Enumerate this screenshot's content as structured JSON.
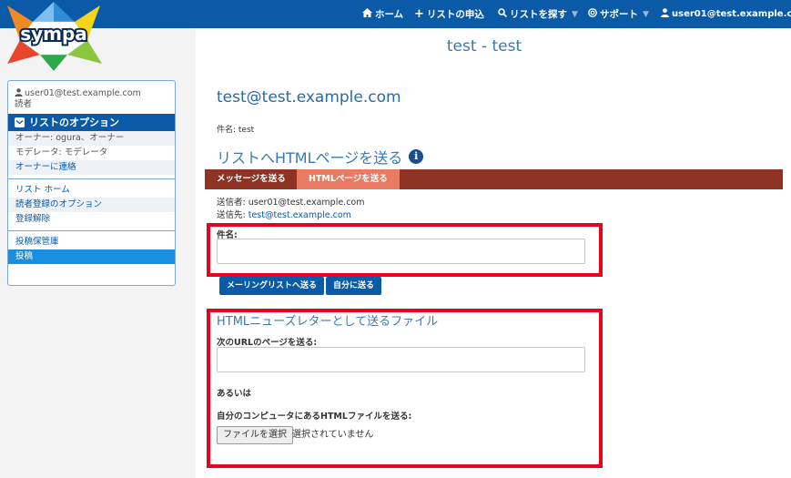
{
  "topnav": {
    "home": "ホーム",
    "request_list": "リストの申込",
    "search_list": "リストを探す",
    "support": "サポート",
    "user": "user01@test.example.com"
  },
  "logo": {
    "text": "sympa"
  },
  "sidebar": {
    "user_email": "user01@test.example.com",
    "user_role": "読者",
    "options_header": "リストのオプション",
    "owner": "オーナー: ogura、オーナー",
    "moderator": "モデレータ: モデレータ",
    "contact_owner": "オーナーに連絡",
    "list_home": "リスト ホーム",
    "subscriber_options": "読者登録のオプション",
    "unsubscribe": "登録解除",
    "archives": "投稿保管庫",
    "post": "投稿"
  },
  "main": {
    "list_title": "test - test",
    "list_address": "test@test.example.com",
    "subject_line": "件名: test",
    "section_title": "リストへHTMLページを送る",
    "tabs": [
      "メッセージを送る",
      "HTMLページを送る"
    ],
    "sender": "送信者: user01@test.example.com",
    "recipient_label": "送信先: ",
    "recipient": "test@test.example.com",
    "subject_label": "件名:",
    "subject_value": "",
    "send_to_list_button": "メーリングリストへ送る",
    "send_to_self_button": "自分に送る",
    "newsletter_title": "HTMLニューズレターとして送るファイル",
    "url_label": "次のURLのページを送る:",
    "url_value": "",
    "or_label": "あるいは",
    "local_file_label": "自分のコンピュータにあるHTMLファイルを送る:",
    "choose_file_button": "ファイルを選択",
    "no_file_selected": "選択されていません"
  },
  "colors": {
    "topbar": "#0a5aa8",
    "tabbar": "#8f3325",
    "active_tab": "#e97b62",
    "highlight_box": "#e8001c"
  }
}
